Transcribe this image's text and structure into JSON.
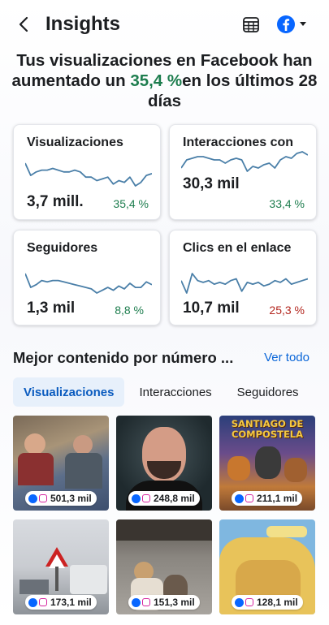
{
  "header": {
    "title": "Insights"
  },
  "headline": {
    "prefix": "Tus visualizaciones en Facebook han aumentado un ",
    "percent": "35,4 %",
    "suffix": "en los últimos 28 días"
  },
  "metrics": [
    {
      "title": "Visualizaciones",
      "value": "3,7 mill.",
      "change": "35,4 %",
      "trend": "up",
      "spark": [
        14,
        7,
        9,
        10,
        10,
        11,
        10,
        9,
        9,
        10,
        9,
        6,
        6,
        4,
        5,
        6,
        2,
        4,
        3,
        6,
        1,
        3,
        7,
        8
      ]
    },
    {
      "title": "Interacciones con",
      "value": "30,3 mil",
      "change": "33,4 %",
      "trend": "up",
      "spark": [
        3,
        8,
        9,
        10,
        10,
        9,
        8,
        8,
        6,
        8,
        9,
        8,
        1,
        4,
        3,
        5,
        6,
        3,
        8,
        10,
        9,
        12,
        13,
        11
      ]
    },
    {
      "title": "Seguidores",
      "value": "1,3 mil",
      "change": "8,8 %",
      "trend": "up",
      "spark": [
        16,
        6,
        8,
        11,
        10,
        11,
        11,
        10,
        9,
        8,
        7,
        6,
        5,
        2,
        4,
        6,
        4,
        7,
        5,
        9,
        6,
        6,
        10,
        8
      ]
    },
    {
      "title": "Clics en el enlace",
      "value": "10,7 mil",
      "change": "25,3 %",
      "trend": "down",
      "spark": [
        10,
        3,
        14,
        10,
        9,
        10,
        8,
        9,
        8,
        10,
        11,
        4,
        9,
        8,
        9,
        7,
        8,
        10,
        9,
        11,
        8,
        9,
        10,
        11
      ]
    }
  ],
  "section": {
    "title": "Mejor contenido por número ...",
    "see_all": "Ver todo"
  },
  "tabs": [
    "Visualizaciones",
    "Interacciones",
    "Seguidores"
  ],
  "posts": [
    {
      "views": "501,3 mil"
    },
    {
      "views": "248,8 mil"
    },
    {
      "views": "211,1 mil",
      "image_text": "SANTIAGO DE COMPOSTELA"
    },
    {
      "views": "173,1 mil"
    },
    {
      "views": "151,3 mil"
    },
    {
      "views": "128,1 mil"
    }
  ],
  "colors": {
    "positive": "#1d7d4e",
    "negative": "#b3261e",
    "accent": "#0a66d8",
    "spark": "#4a7fa8"
  }
}
